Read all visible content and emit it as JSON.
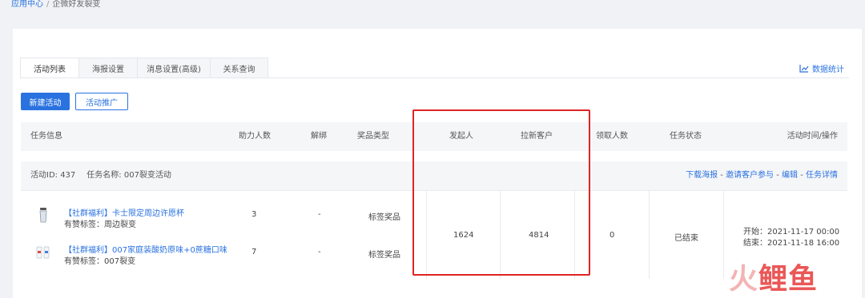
{
  "breadcrumb": {
    "root": "应用中心",
    "separator": "/",
    "current": "企微好友裂变"
  },
  "tabs": [
    {
      "label": "活动列表",
      "active": true
    },
    {
      "label": "海报设置",
      "active": false
    },
    {
      "label": "消息设置(高级)",
      "active": false
    },
    {
      "label": "关系查询",
      "active": false
    }
  ],
  "stats_link": {
    "icon": "chart-icon",
    "label": "数据统计"
  },
  "actions": {
    "new_activity": "新建活动",
    "promote": "活动推广"
  },
  "table": {
    "headers": [
      "任务信息",
      "助力人数",
      "解绑",
      "奖品类型",
      "发起人",
      "拉新客户",
      "领取人数",
      "任务状态",
      "活动时间/操作"
    ],
    "group": {
      "activity_id_label": "活动ID: 437",
      "task_name_label": "任务名称: 007裂变活动",
      "ops": [
        "下载海报",
        "邀请客户参与",
        "编辑",
        "任务详情"
      ],
      "op_separator": " - "
    },
    "products": [
      {
        "icon": "cup-icon",
        "title": "【社群福利】卡士限定周边许愿杯",
        "tag": "有赞标签：周边裂变",
        "helpers": "3",
        "unbind": "-",
        "prize_type": "标签奖品"
      },
      {
        "icon": "yogurt-icon",
        "title": "【社群福利】007家庭装酸奶原味+0蔗糖口味",
        "tag": "有赞标签：007裂变",
        "helpers": "7",
        "unbind": "-",
        "prize_type": "标签奖品"
      }
    ],
    "summary": {
      "initiators": "1624",
      "new_customers": "4814",
      "claimed": "0",
      "status": "已结束",
      "start": "开始：2021-11-17 00:00",
      "end": "结束：2021-11-18 16:00"
    }
  },
  "watermark": {
    "part1": "火",
    "part2": "鲤鱼"
  },
  "colors": {
    "primary": "#2a72e0",
    "highlight_box": "#e02424",
    "watermark": "#e83a3a"
  }
}
